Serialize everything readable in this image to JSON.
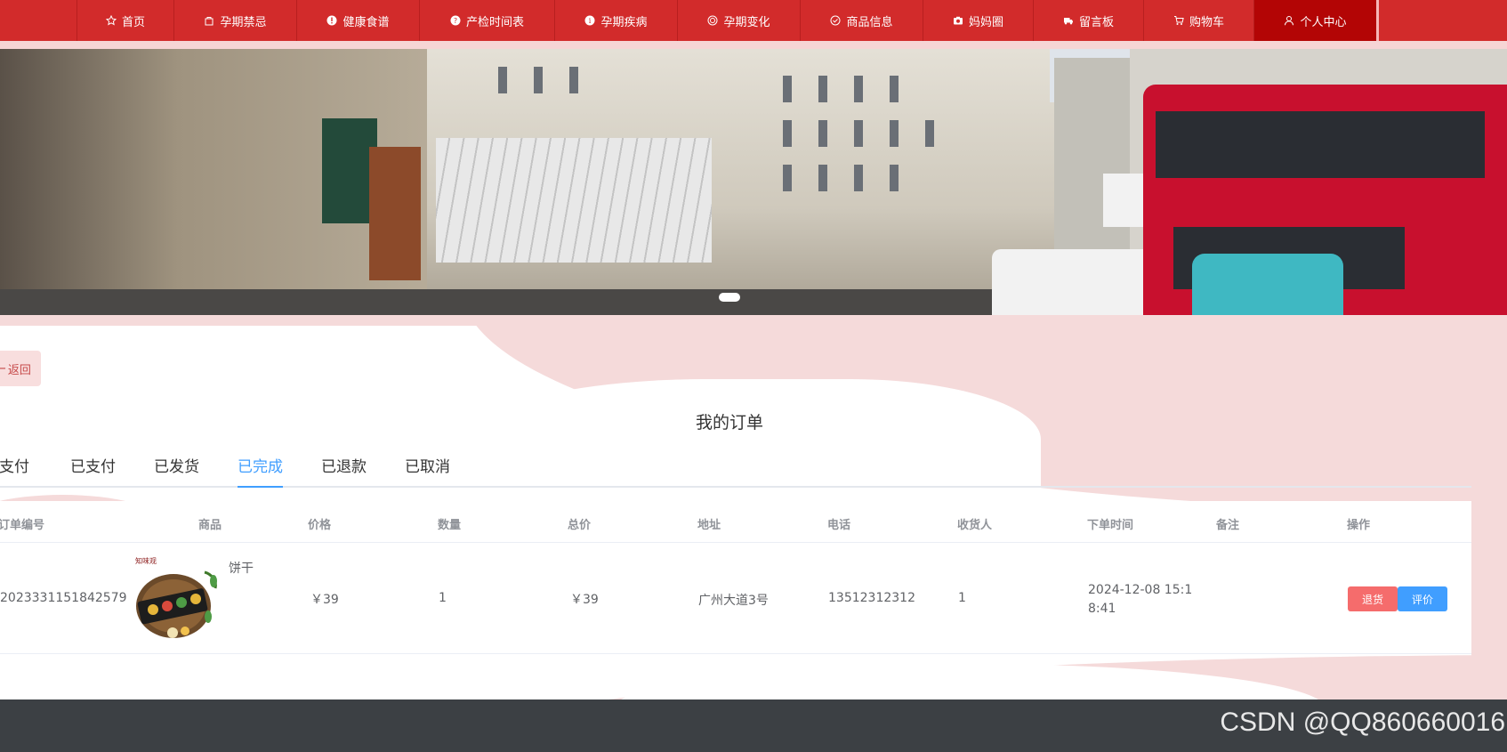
{
  "nav": {
    "items": [
      {
        "label": "首页",
        "icon": "star-icon"
      },
      {
        "label": "孕期禁忌",
        "icon": "bag-icon"
      },
      {
        "label": "健康食谱",
        "icon": "warning-circle-icon"
      },
      {
        "label": "产检时间表",
        "icon": "question-circle-icon"
      },
      {
        "label": "孕期疾病",
        "icon": "info-circle-icon"
      },
      {
        "label": "孕期变化",
        "icon": "target-icon"
      },
      {
        "label": "商品信息",
        "icon": "check-circle-icon"
      },
      {
        "label": "妈妈圈",
        "icon": "camera-icon"
      },
      {
        "label": "留言板",
        "icon": "truck-icon"
      },
      {
        "label": "购物车",
        "icon": "cart-icon"
      },
      {
        "label": "个人中心",
        "icon": "user-icon"
      }
    ],
    "active_index": 10
  },
  "back_button": {
    "label": "返回"
  },
  "page_title": "我的订单",
  "tabs": [
    {
      "label": "未支付"
    },
    {
      "label": "已支付"
    },
    {
      "label": "已发货"
    },
    {
      "label": "已完成"
    },
    {
      "label": "已退款"
    },
    {
      "label": "已取消"
    }
  ],
  "active_tab": 3,
  "table": {
    "headers": [
      "订单编号",
      "商品",
      "价格",
      "数量",
      "总价",
      "地址",
      "电话",
      "收货人",
      "下单时间",
      "备注",
      "操作"
    ],
    "rows": [
      {
        "order_no": "2023331151842579",
        "product_name": "饼干",
        "price": "￥39",
        "quantity": "1",
        "total": "￥39",
        "address": "广州大道3号",
        "phone": "13512312312",
        "receiver": "1",
        "order_time": "2024-12-08 15:18:41",
        "remark": "",
        "actions": {
          "refund": "退货",
          "review": "评价"
        }
      }
    ]
  },
  "colors": {
    "nav_bg": "#d22b2b",
    "nav_active": "#b30505",
    "accent": "#409eff",
    "refund_btn": "#f56c6c",
    "review_btn": "#409eff",
    "page_bg": "#f5dada",
    "footer": "#3c4044"
  },
  "watermark": "CSDN @QQ860660016"
}
